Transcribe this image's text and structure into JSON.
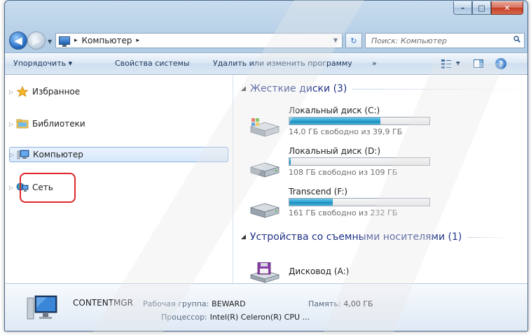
{
  "window": {
    "caption_buttons": {
      "minimize_glyph": "–",
      "maximize_glyph": "□",
      "close_glyph": "✕"
    }
  },
  "address": {
    "back_glyph": "◀",
    "forward_glyph": "▶",
    "history_dropdown_glyph": "▼",
    "breadcrumb": "Компьютер",
    "crumb_arrow": "▸",
    "root_arrow": "▸",
    "dropdown_glyph": "▼",
    "refresh_glyph": "↻",
    "search_placeholder": "Поиск: Компьютер",
    "search_icon": "search-icon"
  },
  "toolbar": {
    "organize": "Упорядочить ▾",
    "system_properties": "Свойства системы",
    "uninstall": "Удалить или изменить программу",
    "more": "»",
    "views_drop": "▾",
    "help_glyph": "?"
  },
  "nav": {
    "items": [
      {
        "label": "Избранное",
        "icon": "star-icon"
      },
      {
        "label": "Библиотеки",
        "icon": "library-icon"
      },
      {
        "label": "Компьютер",
        "icon": "computer-icon"
      },
      {
        "label": "Сеть",
        "icon": "network-icon"
      }
    ],
    "expand_glyph": "▷"
  },
  "groups": {
    "hard_drives": {
      "title": "Жесткие диски (3)",
      "collapse_glyph": "◢"
    },
    "removable": {
      "title": "Устройства со съемными носителями (1)",
      "collapse_glyph": "◢"
    }
  },
  "drives": [
    {
      "name": "Локальный диск (C:)",
      "free": "14,0 ГБ свободно из 39,9 ГБ",
      "used_fraction": 0.65,
      "icon": "windows-drive-icon"
    },
    {
      "name": "Локальный диск (D:)",
      "free": "108 ГБ свободно из 109 ГБ",
      "used_fraction": 0.01,
      "icon": "hard-drive-icon"
    },
    {
      "name": "Transcend (F:)",
      "free": "161 ГБ свободно из 232 ГБ",
      "used_fraction": 0.31,
      "icon": "hard-drive-icon"
    }
  ],
  "removable_drives": [
    {
      "name": "Дисковод (A:)",
      "icon": "floppy-drive-icon"
    }
  ],
  "details": {
    "computer_name": "CONTENTMGR",
    "workgroup_label": "Рабочая группа:",
    "workgroup_value": "BEWARD",
    "memory_label": "Память:",
    "memory_value": "4,00 ГБ",
    "cpu_label": "Процессор:",
    "cpu_value": "Intel(R) Celeron(R) CPU ..."
  },
  "colors": {
    "accent_bar": "#27a2d3",
    "highlight_ring": "#e0262a",
    "group_header": "#1e3287"
  }
}
